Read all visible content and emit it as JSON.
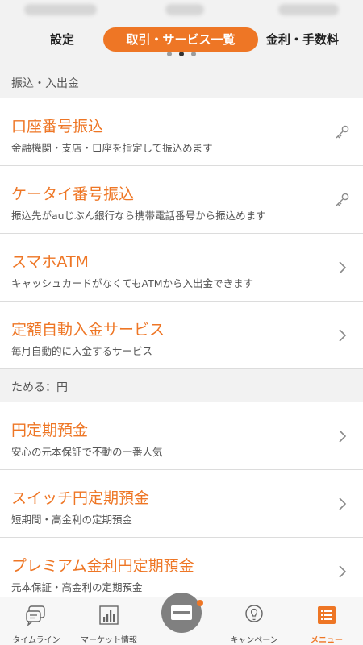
{
  "tabs": {
    "left": "設定",
    "active": "取引・サービス一覧",
    "right": "金利・手数料"
  },
  "sections": [
    {
      "header": "振込・入出金",
      "items": [
        {
          "title": "口座番号振込",
          "subtitle": "金融機関・支店・口座を指定して振込めます",
          "icon": "key-icon"
        },
        {
          "title": "ケータイ番号振込",
          "subtitle": "振込先がauじぶん銀行なら携帯電話番号から振込めます",
          "icon": "key-icon"
        },
        {
          "title": "スマホATM",
          "subtitle": "キャッシュカードがなくてもATMから入出金できます",
          "icon": "chevron-right-icon"
        },
        {
          "title": "定額自動入金サービス",
          "subtitle": "毎月自動的に入金するサービス",
          "icon": "chevron-right-icon"
        }
      ]
    },
    {
      "header": "ためる：円",
      "items": [
        {
          "title": "円定期預金",
          "subtitle": "安心の元本保証で不動の一番人気",
          "icon": "chevron-right-icon"
        },
        {
          "title": "スイッチ円定期預金",
          "subtitle": "短期間・高金利の定期預金",
          "icon": "chevron-right-icon"
        },
        {
          "title": "プレミアム金利円定期預金",
          "subtitle": "元本保証・高金利の定期預金",
          "icon": "chevron-right-icon"
        }
      ]
    }
  ],
  "bottom_nav": [
    {
      "label": "タイムライン",
      "icon": "chat-bubble-icon"
    },
    {
      "label": "マーケット情報",
      "icon": "bar-chart-icon"
    },
    {
      "label": "",
      "icon": "card-icon"
    },
    {
      "label": "キャンペーン",
      "icon": "lightbulb-icon"
    },
    {
      "label": "メニュー",
      "icon": "menu-icon"
    }
  ],
  "colors": {
    "accent": "#ee7625",
    "chevron": "#8a8a8a",
    "header_bg": "#f2f2f2"
  }
}
